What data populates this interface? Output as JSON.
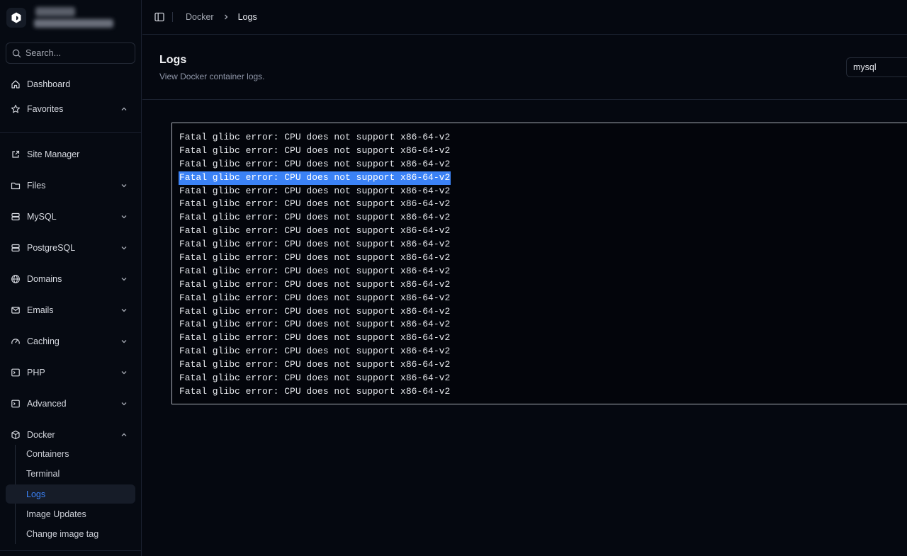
{
  "search": {
    "placeholder": "Search..."
  },
  "nav": {
    "dashboard": "Dashboard",
    "favorites": "Favorites",
    "site_manager": "Site Manager",
    "files": "Files",
    "mysql": "MySQL",
    "postgresql": "PostgreSQL",
    "domains": "Domains",
    "emails": "Emails",
    "caching": "Caching",
    "php": "PHP",
    "advanced": "Advanced",
    "docker": "Docker"
  },
  "docker_sub": {
    "containers": "Containers",
    "terminal": "Terminal",
    "logs": "Logs",
    "image_updates": "Image Updates",
    "change_image_tag": "Change image tag"
  },
  "breadcrumb": {
    "parent": "Docker",
    "current": "Logs"
  },
  "header": {
    "title": "Logs",
    "subtitle": "View Docker container logs."
  },
  "container_select": {
    "value": "mysql"
  },
  "log": {
    "selected_index": 3,
    "lines": [
      "Fatal glibc error: CPU does not support x86-64-v2",
      "Fatal glibc error: CPU does not support x86-64-v2",
      "Fatal glibc error: CPU does not support x86-64-v2",
      "Fatal glibc error: CPU does not support x86-64-v2",
      "Fatal glibc error: CPU does not support x86-64-v2",
      "Fatal glibc error: CPU does not support x86-64-v2",
      "Fatal glibc error: CPU does not support x86-64-v2",
      "Fatal glibc error: CPU does not support x86-64-v2",
      "Fatal glibc error: CPU does not support x86-64-v2",
      "Fatal glibc error: CPU does not support x86-64-v2",
      "Fatal glibc error: CPU does not support x86-64-v2",
      "Fatal glibc error: CPU does not support x86-64-v2",
      "Fatal glibc error: CPU does not support x86-64-v2",
      "Fatal glibc error: CPU does not support x86-64-v2",
      "Fatal glibc error: CPU does not support x86-64-v2",
      "Fatal glibc error: CPU does not support x86-64-v2",
      "Fatal glibc error: CPU does not support x86-64-v2",
      "Fatal glibc error: CPU does not support x86-64-v2",
      "Fatal glibc error: CPU does not support x86-64-v2",
      "Fatal glibc error: CPU does not support x86-64-v2"
    ]
  },
  "colors": {
    "accent": "#3b82f6",
    "background": "#050810",
    "border": "#1b2130"
  }
}
